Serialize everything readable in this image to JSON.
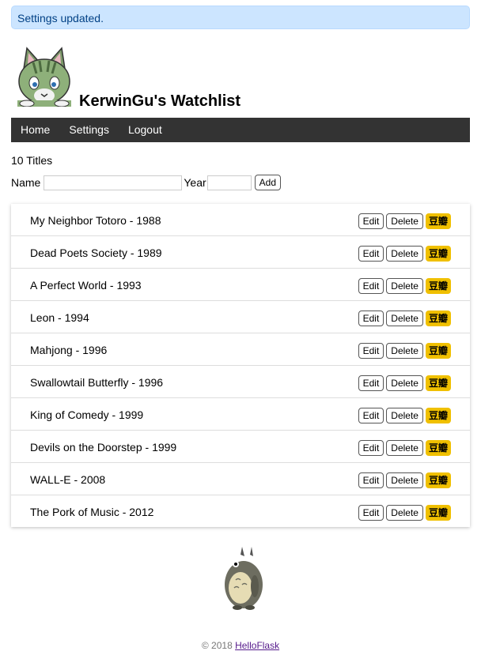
{
  "alert": {
    "text": "Settings updated."
  },
  "header": {
    "title": "KerwinGu's Watchlist",
    "avatar_icon": "cat-avatar-icon"
  },
  "nav": {
    "items": [
      "Home",
      "Settings",
      "Logout"
    ]
  },
  "count_text": "10 Titles",
  "form": {
    "name_label": "Name",
    "name_value": "",
    "year_label": "Year",
    "year_value": "",
    "add_label": "Add"
  },
  "movies": [
    {
      "text": "My Neighbor Totoro - 1988"
    },
    {
      "text": "Dead Poets Society - 1989"
    },
    {
      "text": "A Perfect World - 1993"
    },
    {
      "text": "Leon - 1994"
    },
    {
      "text": "Mahjong - 1996"
    },
    {
      "text": "Swallowtail Butterfly - 1996"
    },
    {
      "text": "King of Comedy - 1999"
    },
    {
      "text": "Devils on the Doorstep - 1999"
    },
    {
      "text": "WALL-E - 2008"
    },
    {
      "text": "The Pork of Music - 2012"
    }
  ],
  "row_actions": {
    "edit": "Edit",
    "delete": "Delete",
    "douban": "豆瓣"
  },
  "footer": {
    "copyright": "© 2018 ",
    "link": "HelloFlask"
  },
  "colors": {
    "alert_bg": "#cce5ff",
    "nav_bg": "#333333",
    "douban_bg": "#f0c000"
  }
}
